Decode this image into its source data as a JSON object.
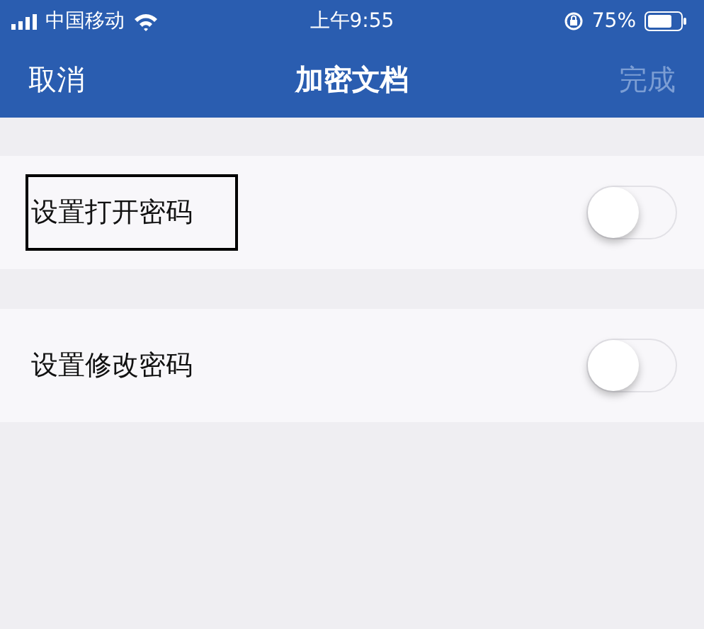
{
  "status_bar": {
    "carrier": "中国移动",
    "time": "上午9:55",
    "battery": "75%"
  },
  "nav": {
    "cancel": "取消",
    "title": "加密文档",
    "done": {
      "label": "完成",
      "disabled": true
    }
  },
  "settings": [
    {
      "label": "设置打开密码",
      "on": false,
      "highlighted": true
    },
    {
      "label": "设置修改密码",
      "on": false,
      "highlighted": false
    }
  ]
}
